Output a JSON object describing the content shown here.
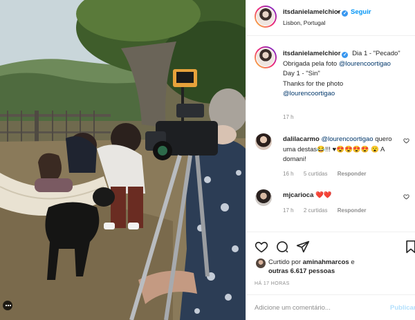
{
  "post": {
    "author": "itsdanielamelchior",
    "follow_label": "Seguir",
    "separator": "•",
    "location": "Lisbon, Portugal",
    "caption_parts": [
      "Dia 1 - \"Pecado\"",
      "Obrigada pela foto",
      "@lourencoortigao",
      "Day 1 - \"Sin\"",
      "Thanks for the photo",
      "@lourencoortigao"
    ],
    "caption_time": "17 h"
  },
  "comments": [
    {
      "user": "dalilacarmo",
      "text_mention": "@lourencoortigao",
      "text_rest": "quero uma destas😂!!! ♥😍😍😍😍 😮 A domani!",
      "time": "16 h",
      "likes": "5 curtidas",
      "reply": "Responder"
    },
    {
      "user": "mjcarioca",
      "text_rest": "❤️❤️",
      "time": "17 h",
      "likes": "2 curtidas",
      "reply": "Responder"
    }
  ],
  "actions": {
    "icons": [
      "heart-icon",
      "comment-icon",
      "share-icon",
      "bookmark-icon"
    ],
    "liked_prefix": "Curtido por",
    "liked_user": "aminahmarcos",
    "liked_mid": "e",
    "liked_others": "outras 6.617 pessoas",
    "ago": "HÁ 17 HORAS",
    "comment_placeholder": "Adicione um comentário...",
    "publish_label": "Publicar"
  },
  "colors": {
    "accent": "#0095f6",
    "verified": "#3897f0",
    "heart": "#ed4956",
    "muted": "#8e8e8e"
  }
}
